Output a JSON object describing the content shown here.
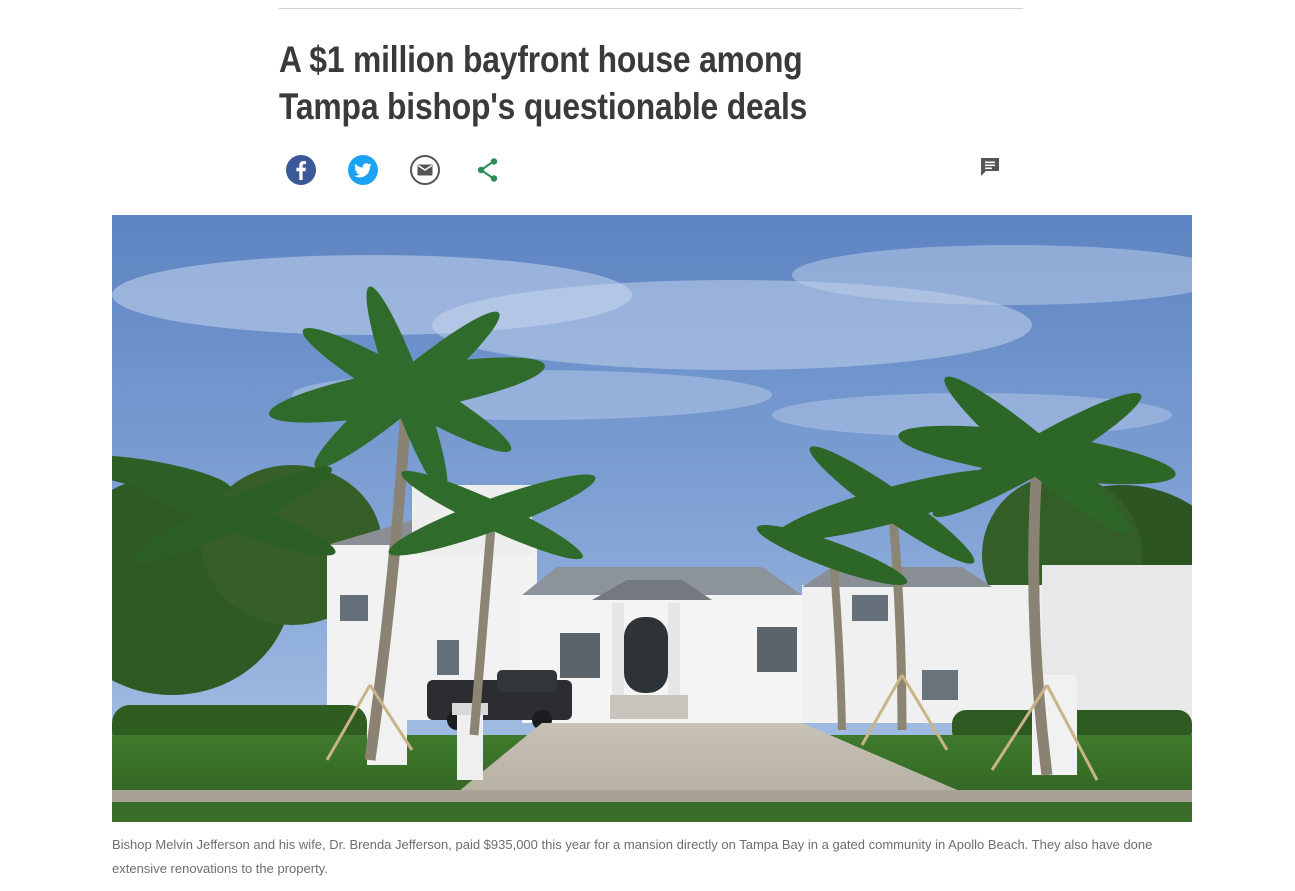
{
  "article": {
    "headline_line1": "A $1 million bayfront house among",
    "headline_line2": "Tampa bishop's questionable deals",
    "caption": "Bishop Melvin Jefferson and his wife, Dr. Brenda Jefferson, paid $935,000 this year for a mansion directly on Tampa Bay in a gated community in Apollo Beach. They also have done extensive renovations to the property."
  },
  "share": {
    "facebook_icon": "facebook-icon",
    "twitter_icon": "twitter-icon",
    "email_icon": "email-icon",
    "share_icon": "share-icon",
    "comments_icon": "comment-icon"
  },
  "colors": {
    "facebook": "#3b5998",
    "twitter": "#1da1f2",
    "email": "#555555",
    "share": "#2e8b57",
    "headline": "#3a3a3a",
    "caption": "#6e6e6e"
  }
}
